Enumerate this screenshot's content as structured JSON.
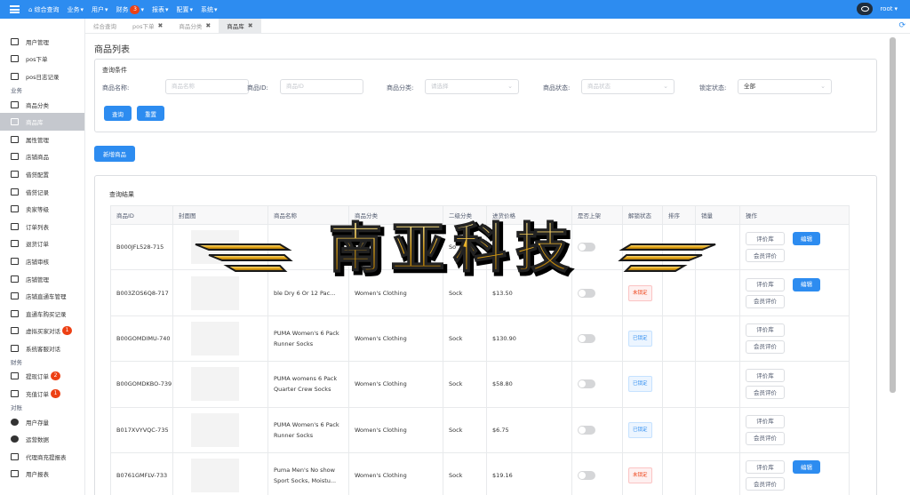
{
  "topbar": {
    "nav": [
      {
        "label": "综合查询",
        "badge": null
      },
      {
        "label": "业务",
        "badge": null
      },
      {
        "label": "用户",
        "badge": null
      },
      {
        "label": "财务",
        "badge": "3"
      },
      {
        "label": "报表",
        "badge": null
      },
      {
        "label": "配置",
        "badge": null
      },
      {
        "label": "系统",
        "badge": null
      }
    ],
    "user": "root"
  },
  "sidebar": {
    "items": [
      {
        "label": "用户管理",
        "icon": "document-icon"
      },
      {
        "label": "pos下单",
        "icon": "book-icon"
      },
      {
        "label": "pos日志记录",
        "icon": "book-icon"
      },
      {
        "group": "业务"
      },
      {
        "label": "商品分类",
        "icon": "laptop-icon"
      },
      {
        "label": "商品库",
        "icon": "laptop-icon",
        "active": true
      },
      {
        "label": "属性管理",
        "icon": "book-icon"
      },
      {
        "label": "店铺商品",
        "icon": "book-icon"
      },
      {
        "label": "借贷配置",
        "icon": "book-icon"
      },
      {
        "label": "借贷记录",
        "icon": "book-icon"
      },
      {
        "label": "卖家等级",
        "icon": "list-icon"
      },
      {
        "label": "订单列表",
        "icon": "order-icon"
      },
      {
        "label": "退货订单",
        "icon": "order-icon"
      },
      {
        "label": "店铺审核",
        "icon": "card-icon"
      },
      {
        "label": "店铺管理",
        "icon": "card-icon"
      },
      {
        "label": "店铺直通车管理",
        "icon": "card-icon"
      },
      {
        "label": "直通车购买记录",
        "icon": "card-icon"
      },
      {
        "label": "虚拟买家对话",
        "icon": "card-icon",
        "badge": "1"
      },
      {
        "label": "系统客服对话",
        "icon": "card-icon"
      },
      {
        "group": "财务"
      },
      {
        "label": "提现订单",
        "icon": "card-icon",
        "badge": "2"
      },
      {
        "label": "充值订单",
        "icon": "card-icon",
        "badge": "1"
      },
      {
        "group": "对账"
      },
      {
        "label": "用户存量",
        "icon": "pie-icon"
      },
      {
        "label": "运营数据",
        "icon": "pie-icon"
      },
      {
        "label": "代理商充提报表",
        "icon": "org-icon"
      },
      {
        "label": "用户报表",
        "icon": "card-icon"
      }
    ]
  },
  "tabs": [
    {
      "label": "综合查询",
      "closable": false
    },
    {
      "label": "pos下单",
      "closable": true
    },
    {
      "label": "商品分类",
      "closable": true
    },
    {
      "label": "商品库",
      "closable": true,
      "active": true
    }
  ],
  "page": {
    "title": "商品列表"
  },
  "query": {
    "title": "查询条件",
    "fields": [
      {
        "label": "商品名称:",
        "placeholder": "商品名称"
      },
      {
        "label": "商品ID:",
        "placeholder": "商品ID"
      },
      {
        "label": "商品分类:",
        "placeholder": "请选择"
      },
      {
        "label": "商品状态:",
        "placeholder": "商品状态"
      },
      {
        "label": "锁定状态:",
        "value": "全部"
      }
    ],
    "search_label": "查询",
    "reset_label": "重置"
  },
  "add_button": "新增商品",
  "results": {
    "title": "查询结果",
    "columns": [
      "商品ID",
      "封面图",
      "商品名称",
      "商品分类",
      "二级分类",
      "进货价格",
      "是否上架",
      "解锁状态",
      "排序",
      "销量",
      "操作"
    ],
    "rows": [
      {
        "id": "B000JFL528-715",
        "name": "Dry",
        "category": "",
        "subcategory": "So",
        "price": "",
        "lock": "",
        "ops": [
          "评价库",
          "编辑",
          "会员评价"
        ]
      },
      {
        "id": "B003ZOS6Q8-717",
        "name": "ble Dry 6 Or 12 Pac...",
        "category": "Women's Clothing",
        "subcategory": "Sock",
        "price": "$13.50",
        "lock": "未锁定",
        "ops": [
          "评价库",
          "编辑",
          "会员评价"
        ]
      },
      {
        "id": "B00GOMDIMU-740",
        "name": "PUMA Women's 6 Pack Runner Socks",
        "category": "Women's Clothing",
        "subcategory": "Sock",
        "price": "$130.90",
        "lock": "已锁定",
        "ops": [
          "评价库",
          "会员评价"
        ]
      },
      {
        "id": "B00GOMDKBO-739",
        "name": "PUMA womens 6 Pack Quarter Crew Socks",
        "category": "Women's Clothing",
        "subcategory": "Sock",
        "price": "$58.80",
        "lock": "已锁定",
        "ops": [
          "评价库",
          "会员评价"
        ]
      },
      {
        "id": "B017XVYVQC-735",
        "name": "PUMA Women's 6 Pack Runner Socks",
        "category": "Women's Clothing",
        "subcategory": "Sock",
        "price": "$6.75",
        "lock": "已锁定",
        "ops": [
          "评价库",
          "会员评价"
        ]
      },
      {
        "id": "B0761GMFLV-733",
        "name": "Puma Men's No show Sport Socks, Moistu...",
        "category": "Women's Clothing",
        "subcategory": "Sock",
        "price": "$19.16",
        "lock": "未锁定",
        "ops": [
          "评价库",
          "编辑",
          "会员评价"
        ]
      }
    ]
  },
  "watermark": {
    "text": "南亚科技"
  },
  "colors": {
    "primary": "#2d8cf0",
    "danger": "#ed4014",
    "watermark_gold": "#e6a817"
  }
}
